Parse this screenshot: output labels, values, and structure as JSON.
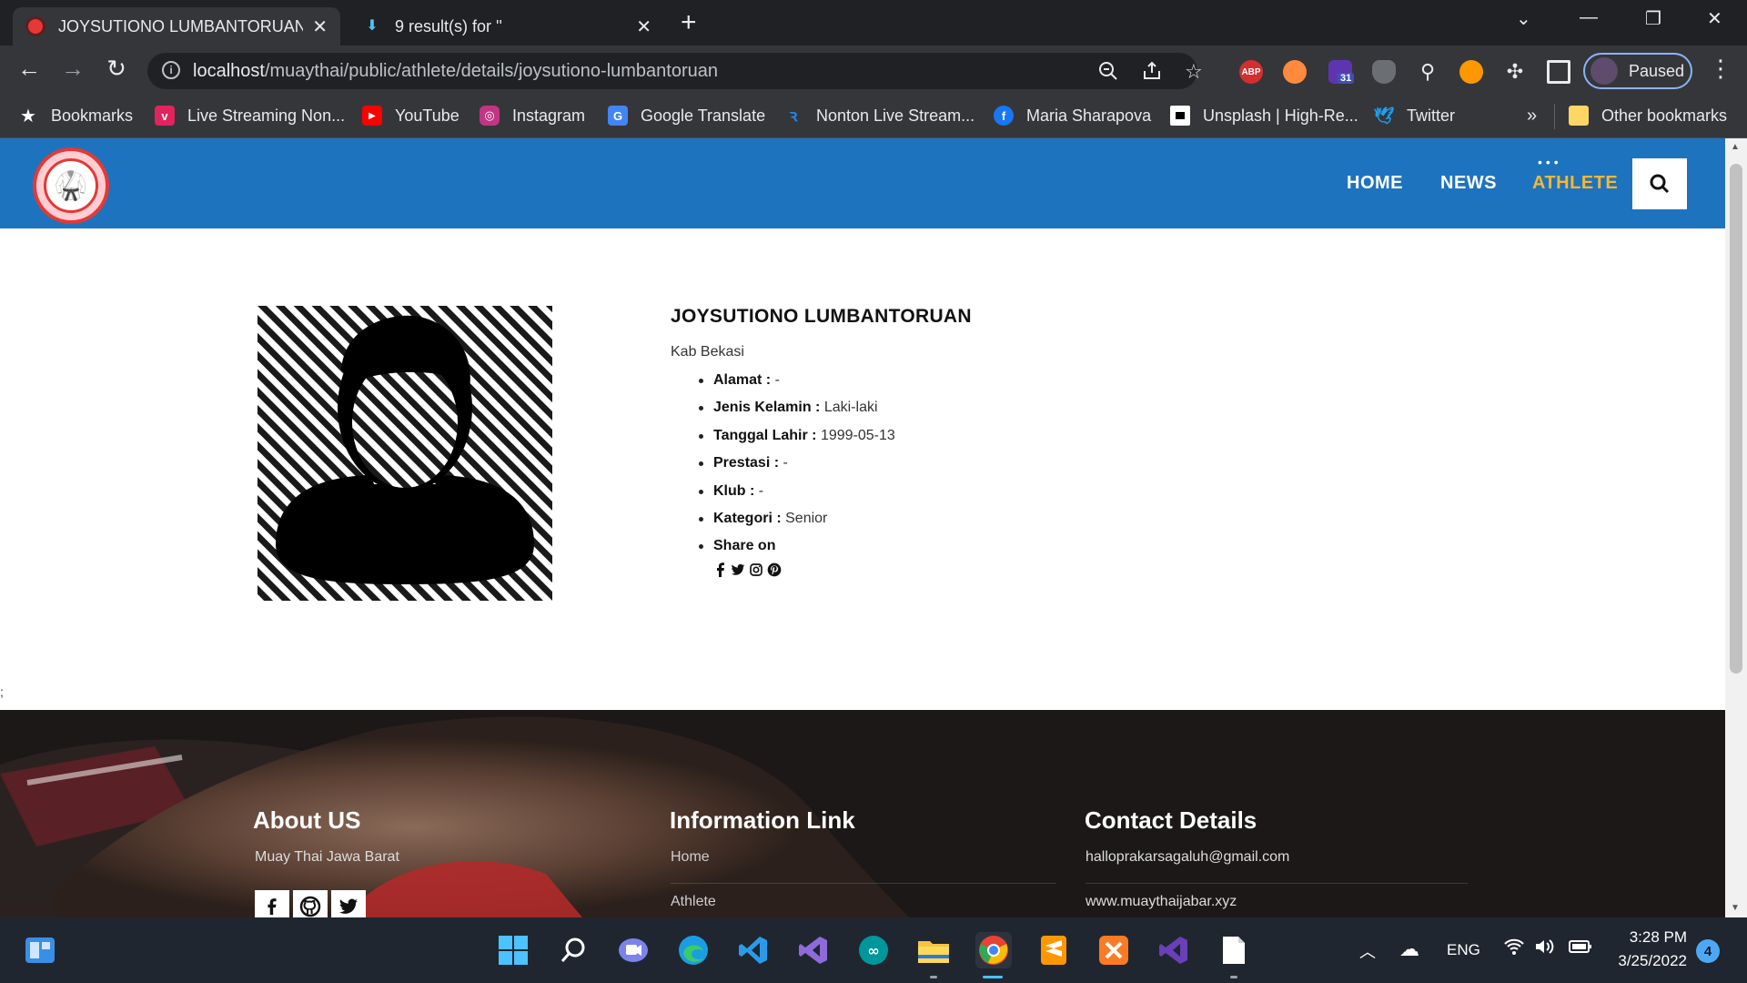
{
  "browser": {
    "tabs": [
      {
        "title": "JOYSUTIONO LUMBANTORUAN",
        "active": true
      },
      {
        "title": "9 result(s) for ''",
        "active": false
      }
    ],
    "url_host": "localhost",
    "url_path": "/muaythai/public/athlete/details/joysutiono-lumbantoruan",
    "profile_label": "Paused",
    "extension_badge": "31",
    "abp_label": "ABP",
    "bookmarks": [
      {
        "label": "Bookmarks",
        "icon": "star-icon"
      },
      {
        "label": "Live Streaming Non...",
        "icon": "vidio-icon"
      },
      {
        "label": "YouTube",
        "icon": "youtube-icon"
      },
      {
        "label": "Instagram",
        "icon": "instagram-icon"
      },
      {
        "label": "Google Translate",
        "icon": "google-translate-icon"
      },
      {
        "label": "Nonton Live Stream...",
        "icon": "rcti-icon"
      },
      {
        "label": "Maria Sharapova",
        "icon": "facebook-icon"
      },
      {
        "label": "Unsplash | High-Re...",
        "icon": "unsplash-icon"
      },
      {
        "label": "Twitter",
        "icon": "twitter-icon"
      }
    ],
    "bookmarks_overflow": "»",
    "other_bookmarks": "Other bookmarks"
  },
  "site": {
    "nav": [
      {
        "label": "HOME",
        "active": false
      },
      {
        "label": "NEWS",
        "active": false
      },
      {
        "label": "ATHLETE",
        "active": true
      }
    ],
    "colors": {
      "header": "#1e73be",
      "active_nav": "#f7b733"
    }
  },
  "athlete": {
    "name": "JOYSUTIONO LUMBANTORUAN",
    "region": "Kab Bekasi",
    "details": [
      {
        "label": "Alamat :",
        "value": "-"
      },
      {
        "label": "Jenis Kelamin :",
        "value": "Laki-laki"
      },
      {
        "label": "Tanggal Lahir :",
        "value": "1999-05-13"
      },
      {
        "label": "Prestasi :",
        "value": "-"
      },
      {
        "label": "Klub :",
        "value": "-"
      },
      {
        "label": "Kategori :",
        "value": "Senior"
      },
      {
        "label": "Share on",
        "value": ""
      }
    ],
    "share_icons": [
      "facebook-icon",
      "twitter-icon",
      "instagram-icon",
      "pinterest-icon"
    ]
  },
  "stray_text": ";",
  "footer": {
    "about": {
      "title": "About US",
      "text": "Muay Thai Jawa Barat"
    },
    "info": {
      "title": "Information Link",
      "links": [
        "Home",
        "Athlete"
      ]
    },
    "contact": {
      "title": "Contact Details",
      "items": [
        "halloprakarsagaluh@gmail.com",
        "www.muaythaijabar.xyz"
      ]
    },
    "social_icons": [
      "facebook-icon",
      "github-icon",
      "twitter-icon"
    ]
  },
  "taskbar": {
    "language": "ENG",
    "time": "3:28 PM",
    "date": "3/25/2022",
    "notifications": "4"
  }
}
